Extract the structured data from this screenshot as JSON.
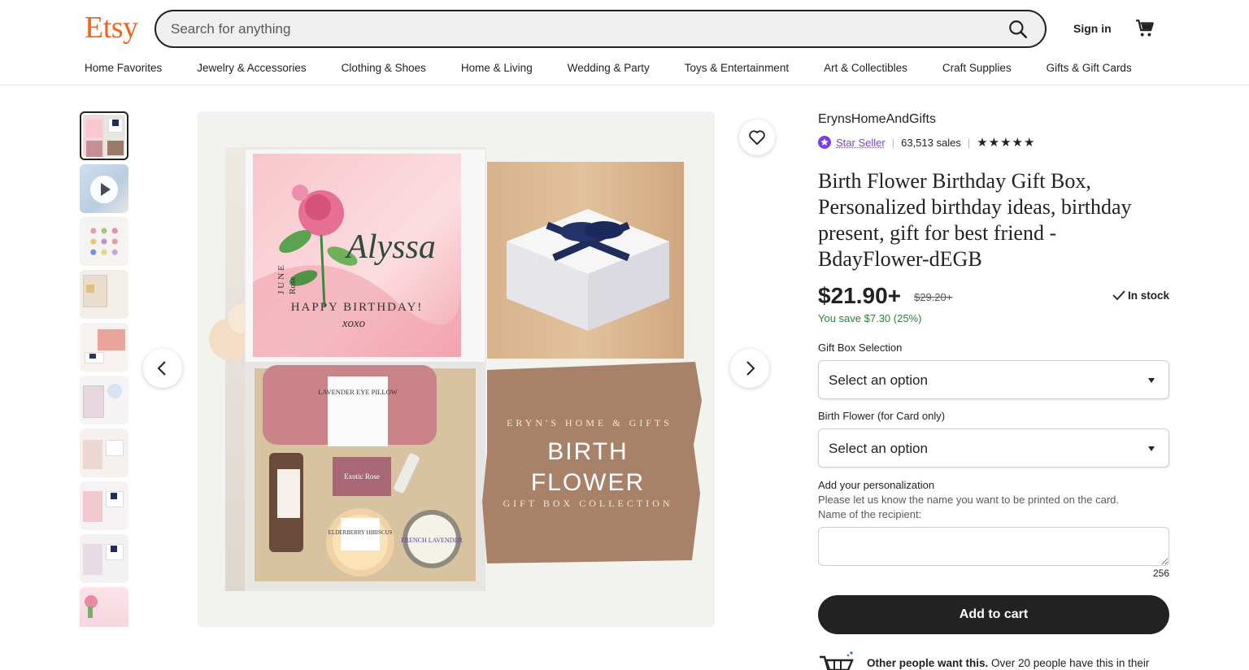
{
  "header": {
    "logo": "Etsy",
    "search_placeholder": "Search for anything",
    "sign_in": "Sign in"
  },
  "nav": [
    "Home Favorites",
    "Jewelry & Accessories",
    "Clothing & Shoes",
    "Home & Living",
    "Wedding & Party",
    "Toys & Entertainment",
    "Art & Collectibles",
    "Craft Supplies",
    "Gifts & Gift Cards"
  ],
  "gallery": {
    "thumb_count": 10,
    "active_index": 0,
    "main_image": {
      "card_name": "Alyssa",
      "card_month": "JUNE",
      "card_flower": "Rose",
      "card_greeting": "HAPPY BIRTHDAY!",
      "card_sign": "xoxo",
      "pillow_label": "LAVENDER EYE PILLOW",
      "soap_label": "Exotic Rose",
      "candle_label": "ELDERBERRY HIBISCUS",
      "tin_label": "FRENCH LAVENDER",
      "brand_line": "ERYN'S HOME & GIFTS",
      "headline_1": "BIRTH",
      "headline_2": "FLOWER",
      "subline": "GIFT BOX COLLECTION"
    }
  },
  "listing": {
    "shop_name": "ErynsHomeAndGifts",
    "star_seller": "Star Seller",
    "sales": "63,513 sales",
    "rating_stars": 5,
    "stars_glyphs": "★★★★★",
    "title": "Birth Flower Birthday Gift Box, Personalized birthday ideas, birthday present, gift for best friend - BdayFlower-dEGB",
    "price": "$21.90+",
    "original_price": "$29.20+",
    "stock": "In stock",
    "savings": "You save $7.30 (25%)",
    "option1_label": "Gift Box Selection",
    "option1_value": "Select an option",
    "option2_label": "Birth Flower (for Card only)",
    "option2_value": "Select an option",
    "personalization_label": "Add your personalization",
    "personalization_hint_1": "Please let us know the name you want to be printed on the card.",
    "personalization_hint_2": "Name of the recipient:",
    "char_count": "256",
    "add_to_cart": "Add to cart",
    "demand_bold": "Other people want this.",
    "demand_rest": " Over 20 people have this in their"
  },
  "colors": {
    "brand": "#f1641e",
    "star_seller": "#7b3fe4",
    "savings": "#258635",
    "button": "#222222"
  }
}
